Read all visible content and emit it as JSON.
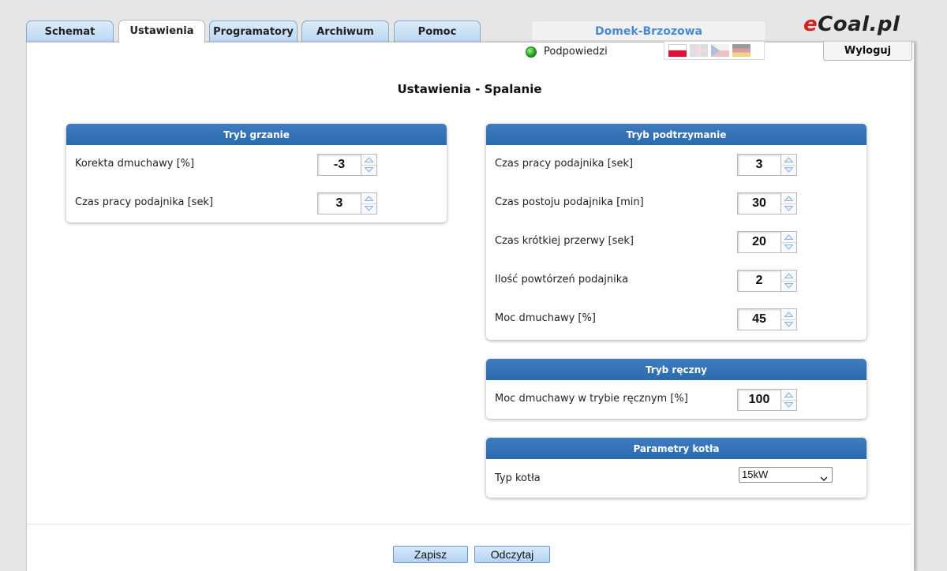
{
  "tabs": [
    {
      "label": "Schemat",
      "active": false
    },
    {
      "label": "Ustawienia",
      "active": true
    },
    {
      "label": "Programatory",
      "active": false
    },
    {
      "label": "Archiwum",
      "active": false
    },
    {
      "label": "Pomoc",
      "active": false
    }
  ],
  "header": {
    "device_name": "Domek-Brzozowa",
    "logo_prefix": "e",
    "logo_rest": "Coal.pl",
    "hints_label": "Podpowiedzi",
    "logout_label": "Wyloguj",
    "flags": [
      "flag-pl-icon",
      "flag-gb-icon",
      "flag-cz-icon",
      "flag-de-icon"
    ]
  },
  "page_title": "Ustawienia - Spalanie",
  "heating": {
    "title": "Tryb grzanie",
    "rows": [
      {
        "label": "Korekta dmuchawy [%]",
        "value": "-3"
      },
      {
        "label": "Czas pracy podajnika [sek]",
        "value": "3"
      }
    ]
  },
  "sustain": {
    "title": "Tryb podtrzymanie",
    "rows": [
      {
        "label": "Czas pracy podajnika [sek]",
        "value": "3"
      },
      {
        "label": "Czas postoju podajnika [min]",
        "value": "30"
      },
      {
        "label": "Czas krótkiej przerwy [sek]",
        "value": "20"
      },
      {
        "label": "Ilość powtórzeń podajnika",
        "value": "2"
      },
      {
        "label": "Moc dmuchawy [%]",
        "value": "45"
      }
    ]
  },
  "manual": {
    "title": "Tryb ręczny",
    "rows": [
      {
        "label": "Moc dmuchawy w trybie ręcznym [%]",
        "value": "100"
      }
    ]
  },
  "boiler": {
    "title": "Parametry kotła",
    "type_label": "Typ kotła",
    "type_value": "15kW"
  },
  "actions": {
    "save_label": "Zapisz",
    "read_label": "Odczytaj"
  },
  "colors": {
    "accent": "#2f6fb3",
    "tab": "#c9e0f8",
    "led": "#19a31a",
    "logo_red": "#d7211f"
  }
}
